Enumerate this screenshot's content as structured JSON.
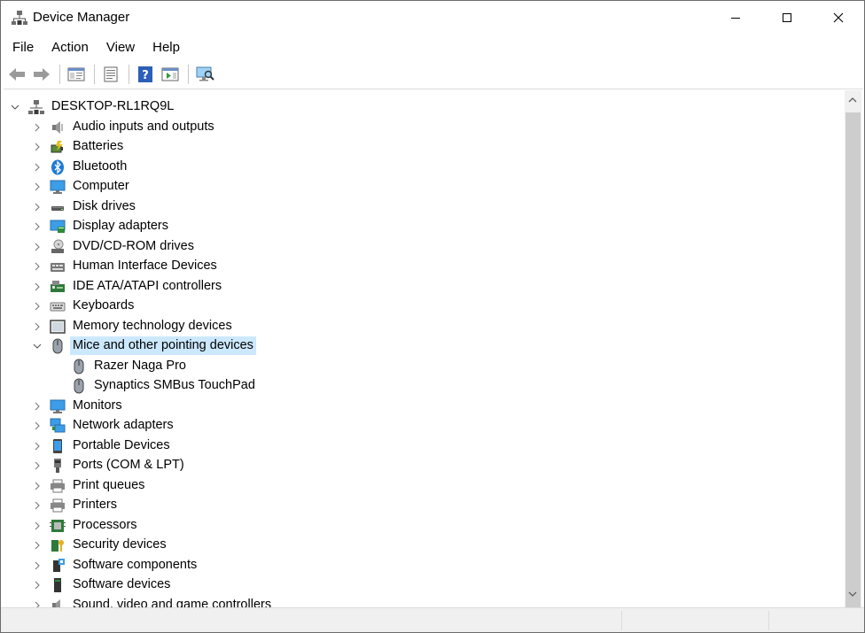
{
  "window": {
    "title": "Device Manager"
  },
  "menu": [
    "File",
    "Action",
    "View",
    "Help"
  ],
  "toolbar": [
    {
      "name": "back-icon"
    },
    {
      "name": "forward-icon"
    },
    {
      "sep": true
    },
    {
      "name": "show-hide-console-tree-icon"
    },
    {
      "sep": true
    },
    {
      "name": "properties-icon"
    },
    {
      "sep": true
    },
    {
      "name": "help-icon"
    },
    {
      "name": "show-action-pane-icon"
    },
    {
      "sep": true
    },
    {
      "name": "scan-hardware-changes-icon"
    }
  ],
  "tree": {
    "root": "DESKTOP-RL1RQ9L",
    "categories": [
      {
        "label": "Audio inputs and outputs",
        "icon": "speaker-icon"
      },
      {
        "label": "Batteries",
        "icon": "battery-icon"
      },
      {
        "label": "Bluetooth",
        "icon": "bluetooth-icon"
      },
      {
        "label": "Computer",
        "icon": "computer-icon"
      },
      {
        "label": "Disk drives",
        "icon": "disk-drive-icon"
      },
      {
        "label": "Display adapters",
        "icon": "display-adapter-icon"
      },
      {
        "label": "DVD/CD-ROM drives",
        "icon": "dvd-drive-icon"
      },
      {
        "label": "Human Interface Devices",
        "icon": "hid-icon"
      },
      {
        "label": "IDE ATA/ATAPI controllers",
        "icon": "ide-controller-icon"
      },
      {
        "label": "Keyboards",
        "icon": "keyboard-icon"
      },
      {
        "label": "Memory technology devices",
        "icon": "memory-icon"
      },
      {
        "label": "Mice and other pointing devices",
        "icon": "mouse-icon",
        "expanded": true,
        "selected": true,
        "children": [
          "Razer Naga Pro",
          "Synaptics SMBus TouchPad"
        ]
      },
      {
        "label": "Monitors",
        "icon": "monitor-icon"
      },
      {
        "label": "Network adapters",
        "icon": "network-adapter-icon"
      },
      {
        "label": "Portable Devices",
        "icon": "portable-device-icon"
      },
      {
        "label": "Ports (COM & LPT)",
        "icon": "port-icon"
      },
      {
        "label": "Print queues",
        "icon": "print-queue-icon"
      },
      {
        "label": "Printers",
        "icon": "printer-icon"
      },
      {
        "label": "Processors",
        "icon": "processor-icon"
      },
      {
        "label": "Security devices",
        "icon": "security-device-icon"
      },
      {
        "label": "Software components",
        "icon": "software-component-icon"
      },
      {
        "label": "Software devices",
        "icon": "software-device-icon"
      },
      {
        "label": "Sound, video and game controllers",
        "icon": "sound-controller-icon"
      }
    ]
  },
  "colors": {
    "selection": "#cce8ff",
    "accent": "#0078d7"
  }
}
